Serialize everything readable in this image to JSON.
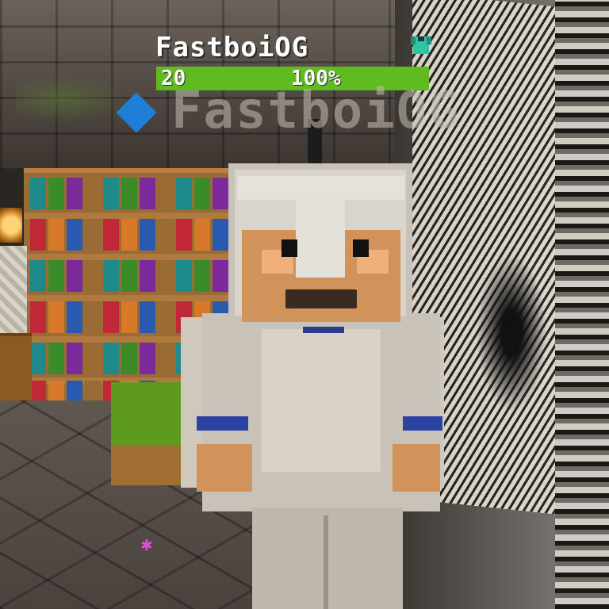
{
  "hud": {
    "player_name": "FastboiOG",
    "level": "20",
    "health_percent_label": "100%",
    "health_fraction": 1.0,
    "armor_icon": "chestplate-icon",
    "bar_color": "#5fbb1f"
  },
  "nametag": {
    "icon": "diamond-icon",
    "icon_color": "#1f7fd6",
    "text": "FastboiOG"
  },
  "scene": {
    "particle_icon": "sparkle-icon",
    "particle_glyph": "✱",
    "particle_color": "#e24ce0"
  }
}
